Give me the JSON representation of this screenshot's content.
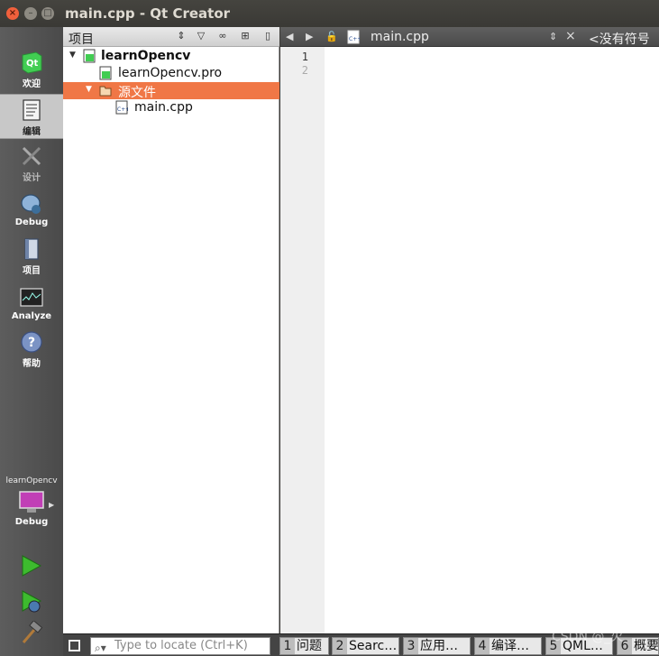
{
  "window": {
    "title": "main.cpp - Qt Creator",
    "close_glyph": "×",
    "min_glyph": "–",
    "max_glyph": "□"
  },
  "modes": [
    {
      "label": "欢迎",
      "icon": "qt-logo-icon"
    },
    {
      "label": "编辑",
      "icon": "edit-document-icon",
      "active": true
    },
    {
      "label": "设计",
      "icon": "design-tools-icon"
    },
    {
      "label": "Debug",
      "icon": "debug-bug-icon"
    },
    {
      "label": "项目",
      "icon": "project-folder-icon"
    },
    {
      "label": "Analyze",
      "icon": "analyze-monitor-icon"
    },
    {
      "label": "帮助",
      "icon": "help-icon"
    }
  ],
  "kit": {
    "project": "learnOpencv",
    "build": "Debug"
  },
  "project_pane": {
    "title": "项目",
    "tree": [
      {
        "label": "learnOpencv",
        "bold": true,
        "expanded": true
      },
      {
        "label": "learnOpencv.pro"
      },
      {
        "label": "源文件",
        "expanded": true,
        "selected": true
      },
      {
        "label": "main.cpp"
      }
    ]
  },
  "editor": {
    "filename": "main.cpp",
    "symbol": "<没有符号>",
    "line_numbers": [
      "1",
      "2"
    ]
  },
  "statusbar": {
    "locator_placeholder": "Type to locate (Ctrl+K)",
    "tabs": [
      {
        "num": "1",
        "label": "问题"
      },
      {
        "num": "2",
        "label": "Searc…"
      },
      {
        "num": "3",
        "label": "应用…"
      },
      {
        "num": "4",
        "label": "编译…"
      },
      {
        "num": "5",
        "label": "QML…"
      },
      {
        "num": "6",
        "label": "概要"
      }
    ]
  },
  "watermark": "CSDN @_火",
  "colors": {
    "selection": "#f07746",
    "close_button": "#f0603c"
  }
}
